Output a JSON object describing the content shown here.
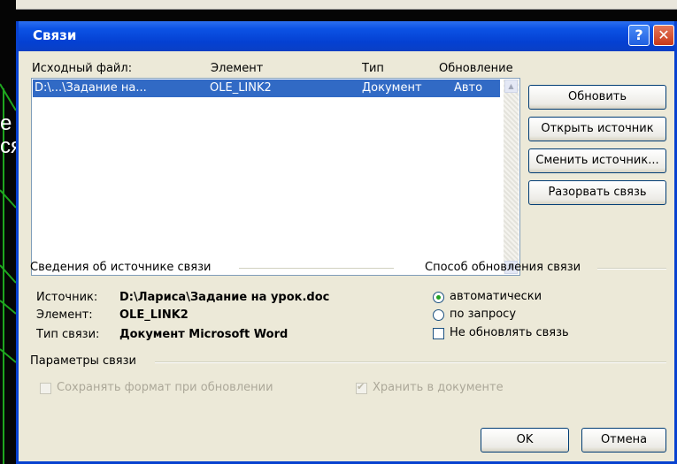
{
  "dialog": {
    "title": "Связи",
    "help_label": "?",
    "close_label": "✕"
  },
  "background": {
    "ruler_text": "",
    "fragment_1": "е",
    "fragment_2": "ся"
  },
  "links_list": {
    "columns": {
      "source": "Исходный файл:",
      "element": "Элемент",
      "type": "Тип",
      "update": "Обновление"
    },
    "rows": [
      {
        "source": "D:\\...\\Задание на...",
        "element": "OLE_LINK2",
        "type": "Документ",
        "update": "Авто"
      }
    ]
  },
  "buttons": {
    "update": "Обновить",
    "open_source": "Открыть источник",
    "change_source": "Сменить источник...",
    "break_link": "Разорвать связь",
    "ok": "OK",
    "cancel": "Отмена"
  },
  "source_info": {
    "group_title": "Сведения об источнике связи",
    "source_label": "Источник:",
    "source_value": "D:\\Лариса\\Задание на урок.doc",
    "element_label": "Элемент:",
    "element_value": "OLE_LINK2",
    "link_type_label": "Тип связи:",
    "link_type_value": "Документ Microsoft Word"
  },
  "update_method": {
    "group_title": "Способ обновления связи",
    "options": [
      {
        "label": "автоматически",
        "selected": true
      },
      {
        "label": "по запросу",
        "selected": false
      }
    ],
    "locked_label": "Не обновлять связь",
    "locked_checked": false
  },
  "link_params": {
    "group_title": "Параметры связи",
    "keep_format_label": "Сохранять формат при обновлении",
    "keep_format_checked": false,
    "keep_format_enabled": false,
    "store_in_doc_label": "Хранить в документе",
    "store_in_doc_checked": true,
    "store_in_doc_enabled": false
  },
  "colors": {
    "titlebar": "#0a48d8",
    "dialog_bg": "#ece9d8",
    "selection": "#316ac5",
    "background": "#050505",
    "decor_lines": "#1fa51f"
  }
}
